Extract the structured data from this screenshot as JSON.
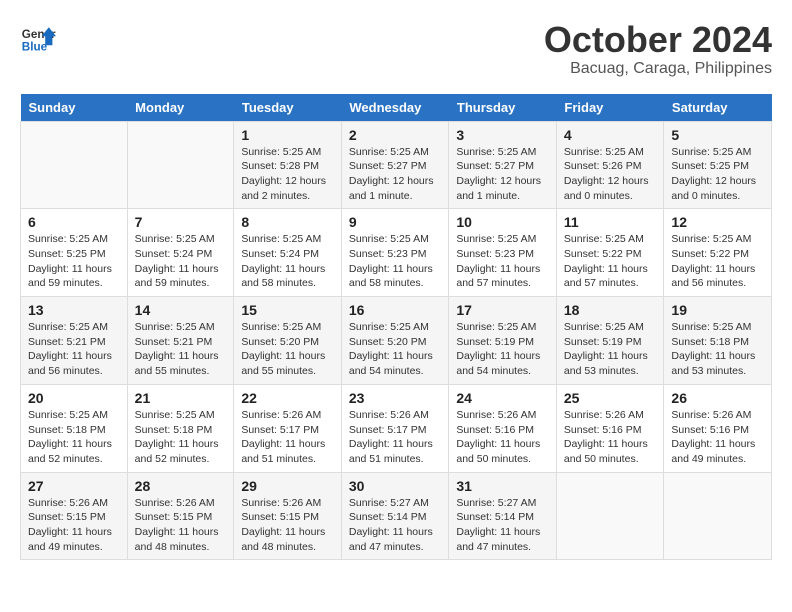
{
  "header": {
    "logo_line1": "General",
    "logo_line2": "Blue",
    "month": "October 2024",
    "location": "Bacuag, Caraga, Philippines"
  },
  "days_of_week": [
    "Sunday",
    "Monday",
    "Tuesday",
    "Wednesday",
    "Thursday",
    "Friday",
    "Saturday"
  ],
  "weeks": [
    [
      {
        "day": "",
        "info": ""
      },
      {
        "day": "",
        "info": ""
      },
      {
        "day": "1",
        "info": "Sunrise: 5:25 AM\nSunset: 5:28 PM\nDaylight: 12 hours\nand 2 minutes."
      },
      {
        "day": "2",
        "info": "Sunrise: 5:25 AM\nSunset: 5:27 PM\nDaylight: 12 hours\nand 1 minute."
      },
      {
        "day": "3",
        "info": "Sunrise: 5:25 AM\nSunset: 5:27 PM\nDaylight: 12 hours\nand 1 minute."
      },
      {
        "day": "4",
        "info": "Sunrise: 5:25 AM\nSunset: 5:26 PM\nDaylight: 12 hours\nand 0 minutes."
      },
      {
        "day": "5",
        "info": "Sunrise: 5:25 AM\nSunset: 5:25 PM\nDaylight: 12 hours\nand 0 minutes."
      }
    ],
    [
      {
        "day": "6",
        "info": "Sunrise: 5:25 AM\nSunset: 5:25 PM\nDaylight: 11 hours\nand 59 minutes."
      },
      {
        "day": "7",
        "info": "Sunrise: 5:25 AM\nSunset: 5:24 PM\nDaylight: 11 hours\nand 59 minutes."
      },
      {
        "day": "8",
        "info": "Sunrise: 5:25 AM\nSunset: 5:24 PM\nDaylight: 11 hours\nand 58 minutes."
      },
      {
        "day": "9",
        "info": "Sunrise: 5:25 AM\nSunset: 5:23 PM\nDaylight: 11 hours\nand 58 minutes."
      },
      {
        "day": "10",
        "info": "Sunrise: 5:25 AM\nSunset: 5:23 PM\nDaylight: 11 hours\nand 57 minutes."
      },
      {
        "day": "11",
        "info": "Sunrise: 5:25 AM\nSunset: 5:22 PM\nDaylight: 11 hours\nand 57 minutes."
      },
      {
        "day": "12",
        "info": "Sunrise: 5:25 AM\nSunset: 5:22 PM\nDaylight: 11 hours\nand 56 minutes."
      }
    ],
    [
      {
        "day": "13",
        "info": "Sunrise: 5:25 AM\nSunset: 5:21 PM\nDaylight: 11 hours\nand 56 minutes."
      },
      {
        "day": "14",
        "info": "Sunrise: 5:25 AM\nSunset: 5:21 PM\nDaylight: 11 hours\nand 55 minutes."
      },
      {
        "day": "15",
        "info": "Sunrise: 5:25 AM\nSunset: 5:20 PM\nDaylight: 11 hours\nand 55 minutes."
      },
      {
        "day": "16",
        "info": "Sunrise: 5:25 AM\nSunset: 5:20 PM\nDaylight: 11 hours\nand 54 minutes."
      },
      {
        "day": "17",
        "info": "Sunrise: 5:25 AM\nSunset: 5:19 PM\nDaylight: 11 hours\nand 54 minutes."
      },
      {
        "day": "18",
        "info": "Sunrise: 5:25 AM\nSunset: 5:19 PM\nDaylight: 11 hours\nand 53 minutes."
      },
      {
        "day": "19",
        "info": "Sunrise: 5:25 AM\nSunset: 5:18 PM\nDaylight: 11 hours\nand 53 minutes."
      }
    ],
    [
      {
        "day": "20",
        "info": "Sunrise: 5:25 AM\nSunset: 5:18 PM\nDaylight: 11 hours\nand 52 minutes."
      },
      {
        "day": "21",
        "info": "Sunrise: 5:25 AM\nSunset: 5:18 PM\nDaylight: 11 hours\nand 52 minutes."
      },
      {
        "day": "22",
        "info": "Sunrise: 5:26 AM\nSunset: 5:17 PM\nDaylight: 11 hours\nand 51 minutes."
      },
      {
        "day": "23",
        "info": "Sunrise: 5:26 AM\nSunset: 5:17 PM\nDaylight: 11 hours\nand 51 minutes."
      },
      {
        "day": "24",
        "info": "Sunrise: 5:26 AM\nSunset: 5:16 PM\nDaylight: 11 hours\nand 50 minutes."
      },
      {
        "day": "25",
        "info": "Sunrise: 5:26 AM\nSunset: 5:16 PM\nDaylight: 11 hours\nand 50 minutes."
      },
      {
        "day": "26",
        "info": "Sunrise: 5:26 AM\nSunset: 5:16 PM\nDaylight: 11 hours\nand 49 minutes."
      }
    ],
    [
      {
        "day": "27",
        "info": "Sunrise: 5:26 AM\nSunset: 5:15 PM\nDaylight: 11 hours\nand 49 minutes."
      },
      {
        "day": "28",
        "info": "Sunrise: 5:26 AM\nSunset: 5:15 PM\nDaylight: 11 hours\nand 48 minutes."
      },
      {
        "day": "29",
        "info": "Sunrise: 5:26 AM\nSunset: 5:15 PM\nDaylight: 11 hours\nand 48 minutes."
      },
      {
        "day": "30",
        "info": "Sunrise: 5:27 AM\nSunset: 5:14 PM\nDaylight: 11 hours\nand 47 minutes."
      },
      {
        "day": "31",
        "info": "Sunrise: 5:27 AM\nSunset: 5:14 PM\nDaylight: 11 hours\nand 47 minutes."
      },
      {
        "day": "",
        "info": ""
      },
      {
        "day": "",
        "info": ""
      }
    ]
  ]
}
